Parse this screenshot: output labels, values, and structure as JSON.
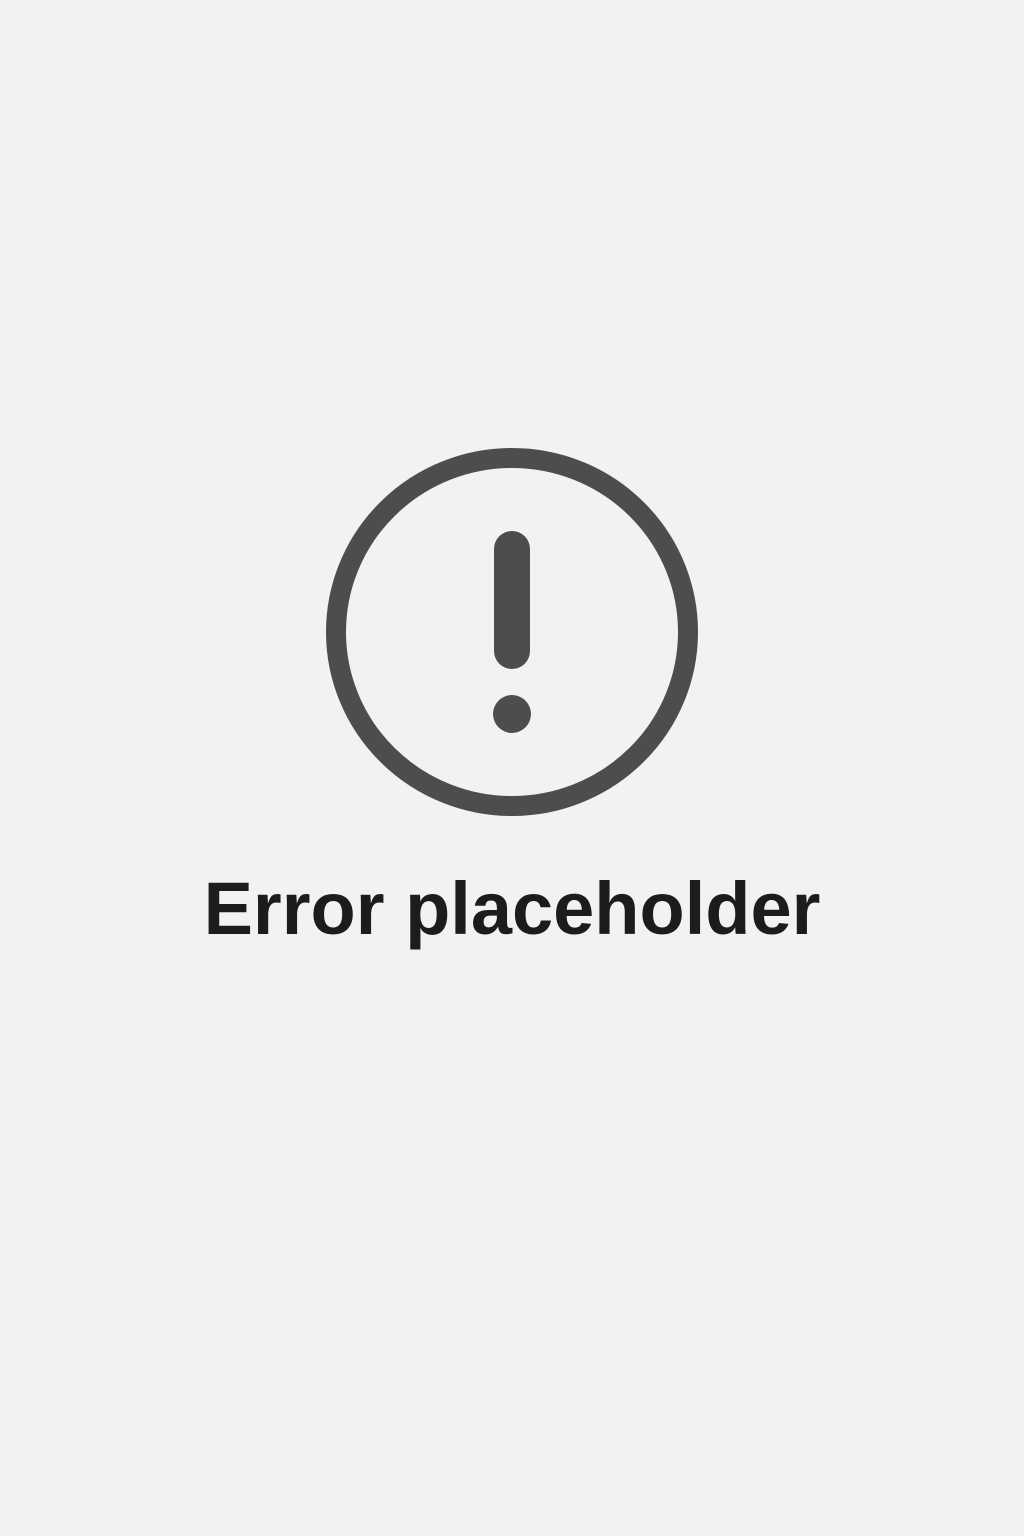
{
  "error": {
    "icon": "exclamation-circle-icon",
    "icon_color": "#4d4d4d",
    "title": "Error placeholder"
  }
}
